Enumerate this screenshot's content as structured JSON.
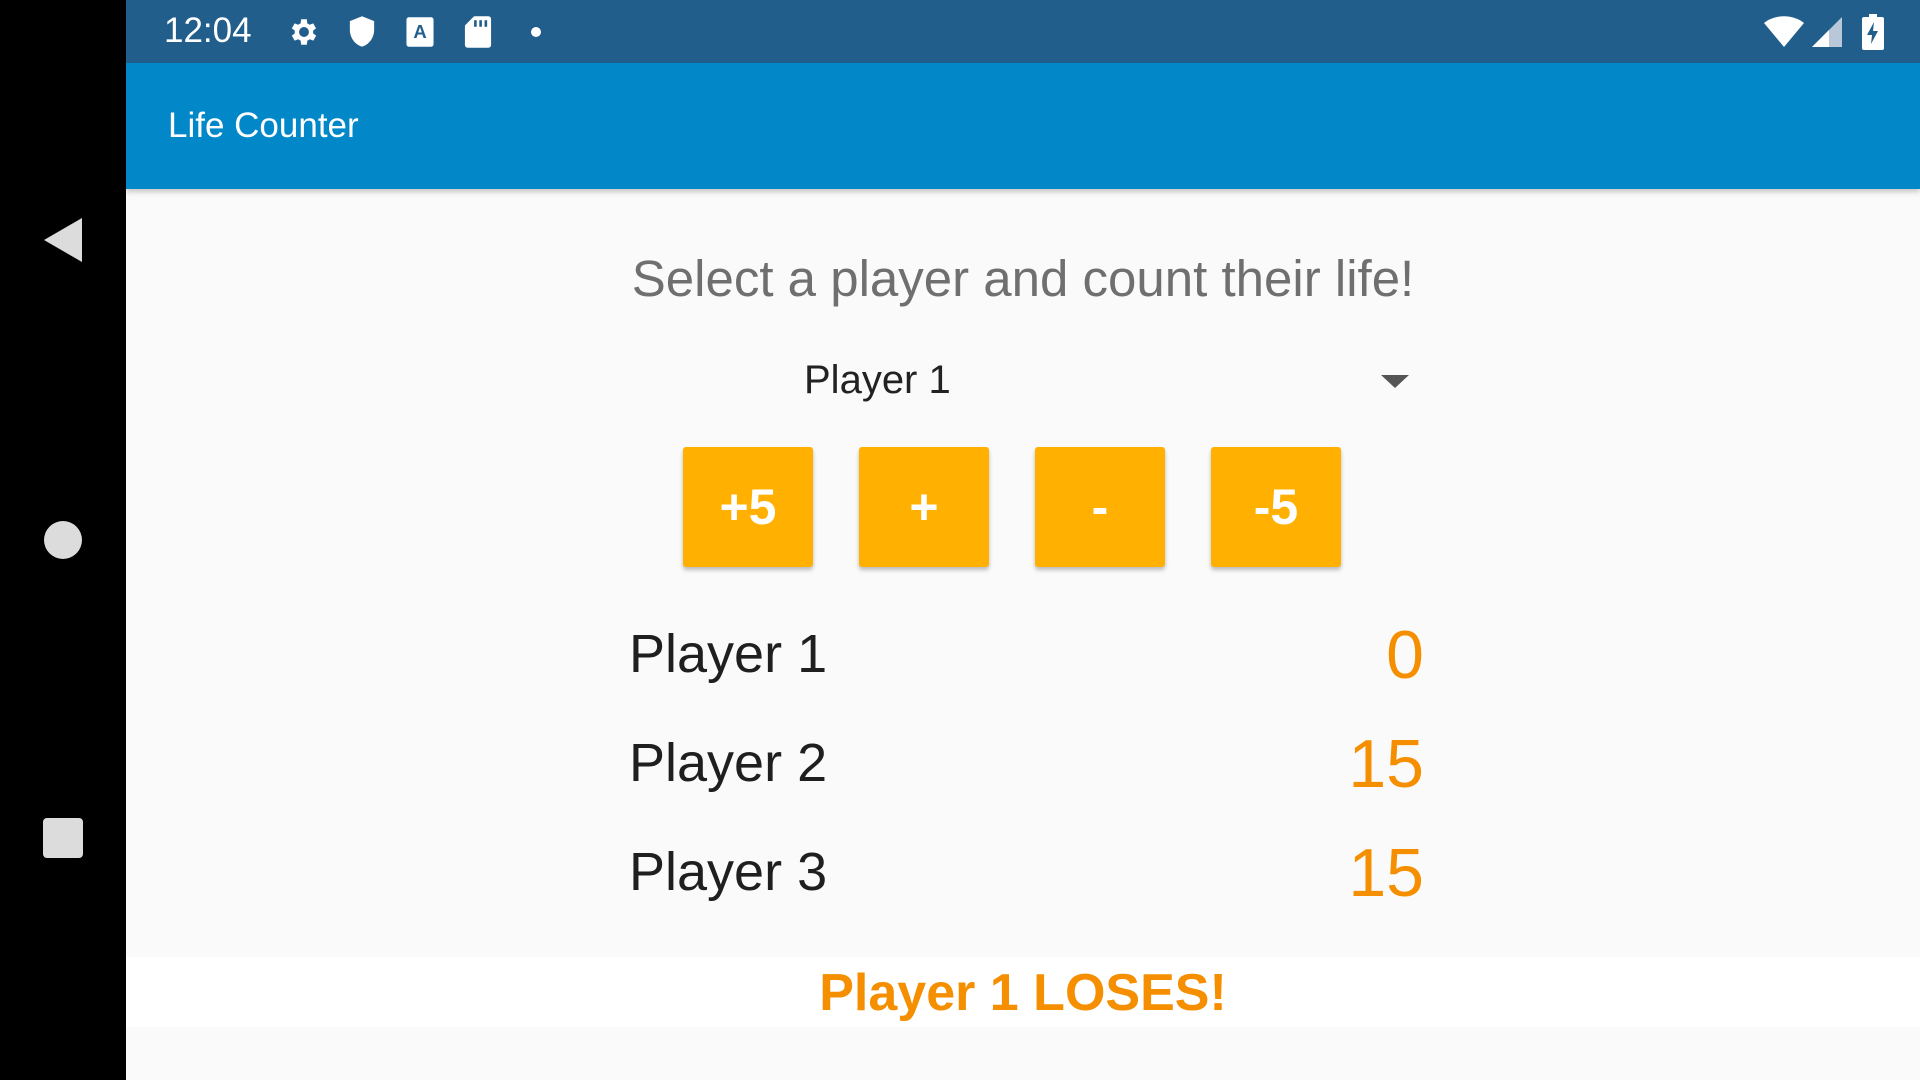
{
  "status_bar": {
    "time": "12:04",
    "icons": [
      "gear-icon",
      "shield-icon",
      "a-notification-icon",
      "sd-card-icon",
      "dot-icon",
      "wifi-icon",
      "signal-icon",
      "battery-charging-icon"
    ]
  },
  "app_bar": {
    "title": "Life Counter",
    "color": "#0288c9"
  },
  "main": {
    "prompt": "Select a player and count their life!",
    "selected_player": "Player 1",
    "buttons": {
      "plus_five": "+5",
      "plus_one": "+",
      "minus_one": "-",
      "minus_five": "-5"
    },
    "players": [
      {
        "name": "Player 1",
        "life": "0"
      },
      {
        "name": "Player 2",
        "life": "15"
      },
      {
        "name": "Player 3",
        "life": "15"
      }
    ],
    "loser_message": "Player 1 LOSES!"
  },
  "colors": {
    "accent": "#ffb000",
    "life_text": "#f58f00",
    "status_bar": "#215e8c"
  },
  "nav_bar": {
    "icons": [
      "back-icon",
      "home-icon",
      "recents-icon"
    ]
  }
}
